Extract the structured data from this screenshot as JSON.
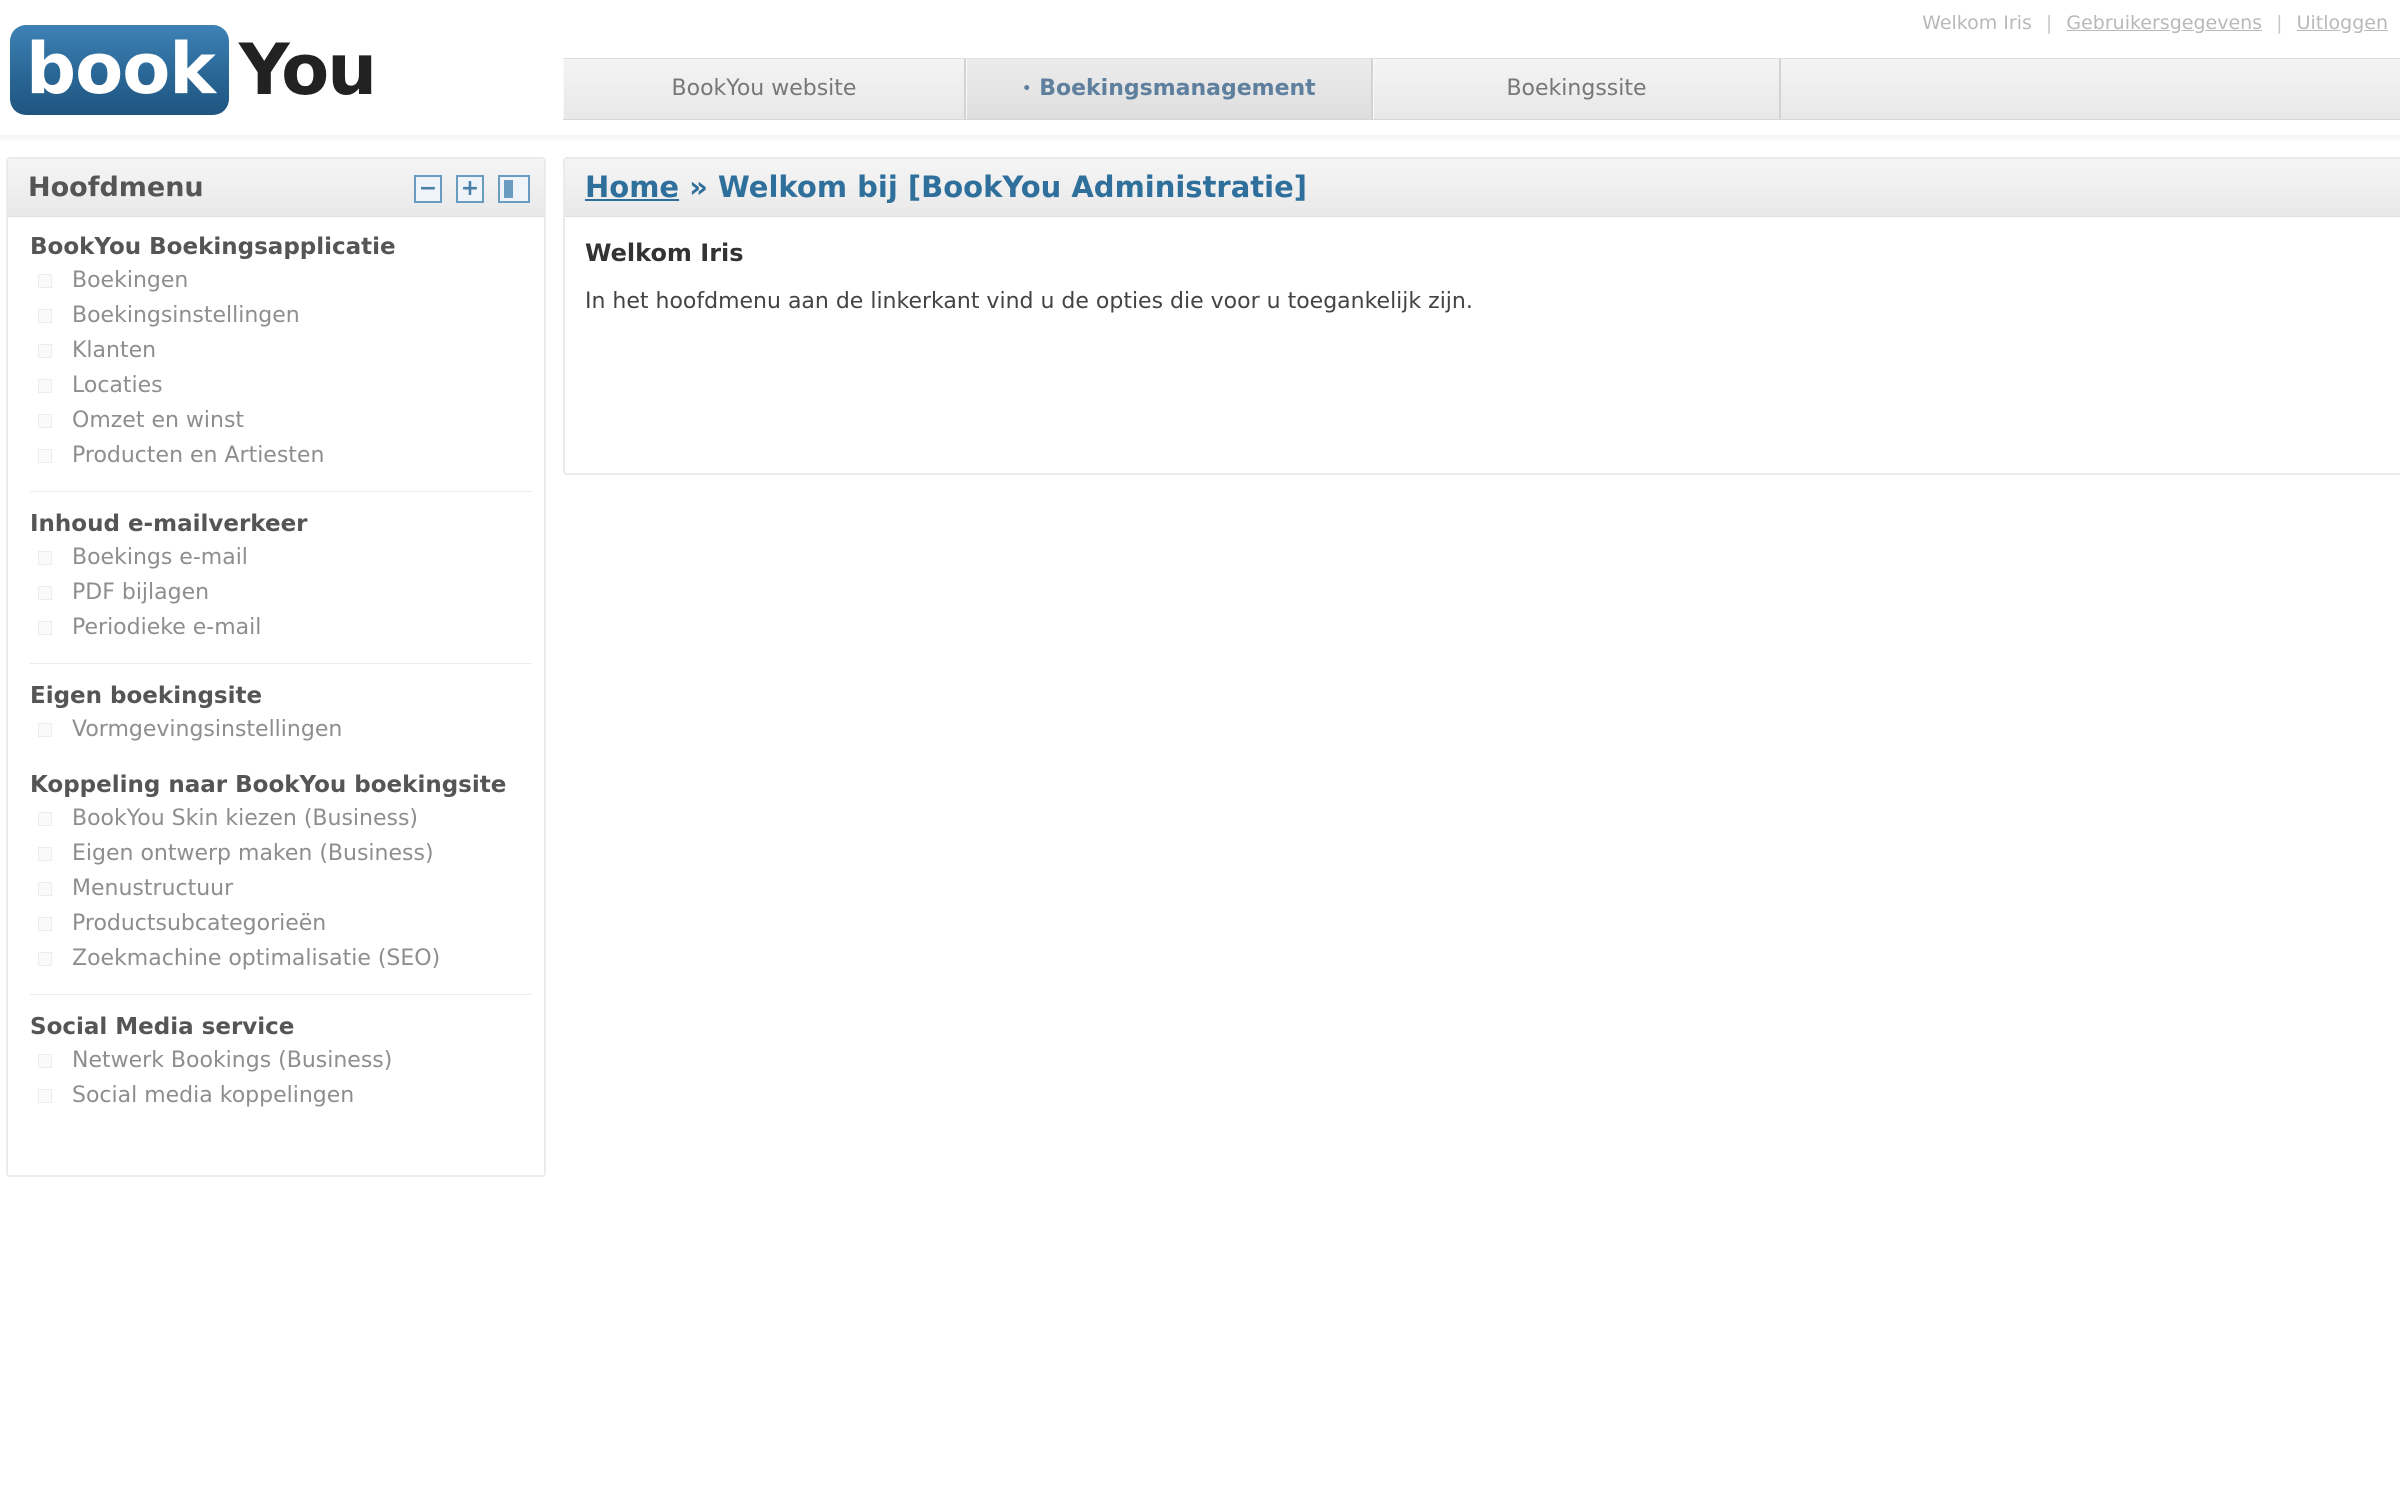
{
  "logo": {
    "part1": "book",
    "part2": "You"
  },
  "toplinks": {
    "greeting": "Welkom Iris",
    "user_details": "Gebruikersgegevens",
    "logout": "Uitloggen",
    "separator": "|"
  },
  "tabs": [
    {
      "label": "BookYou website",
      "active": false
    },
    {
      "label": "Boekingsmanagement",
      "active": true
    },
    {
      "label": "Boekingssite",
      "active": false
    }
  ],
  "sidebar": {
    "title": "Hoofdmenu",
    "sections": [
      {
        "title": "BookYou Boekingsapplicatie",
        "items": [
          "Boekingen",
          "Boekingsinstellingen",
          "Klanten",
          "Locaties",
          "Omzet en winst",
          "Producten en Artiesten"
        ]
      },
      {
        "title": "Inhoud e-mailverkeer",
        "items": [
          "Boekings e-mail",
          "PDF bijlagen",
          "Periodieke e-mail"
        ]
      },
      {
        "title": "Eigen boekingsite",
        "items": [
          "Vormgevingsinstellingen"
        ]
      },
      {
        "title": "Koppeling naar BookYou boekingsite",
        "items": [
          "BookYou Skin kiezen (Business)",
          "Eigen ontwerp maken (Business)",
          "Menustructuur",
          "Productsubcategorieën",
          "Zoekmachine optimalisatie (SEO)"
        ]
      },
      {
        "title": "Social Media service",
        "items": [
          "Netwerk Bookings (Business)",
          "Social media koppelingen"
        ]
      }
    ]
  },
  "content": {
    "breadcrumb_home": "Home",
    "breadcrumb_sep": "»",
    "breadcrumb_current": "Welkom bij [BookYou Administratie]",
    "welcome": "Welkom Iris",
    "intro": "In het hoofdmenu aan de linkerkant vind u de opties die voor u toegankelijk zijn."
  },
  "colors": {
    "brand_blue": "#2b6a9a",
    "link_blue": "#2f6f9c",
    "active_tab_text": "#5f7f9e"
  }
}
